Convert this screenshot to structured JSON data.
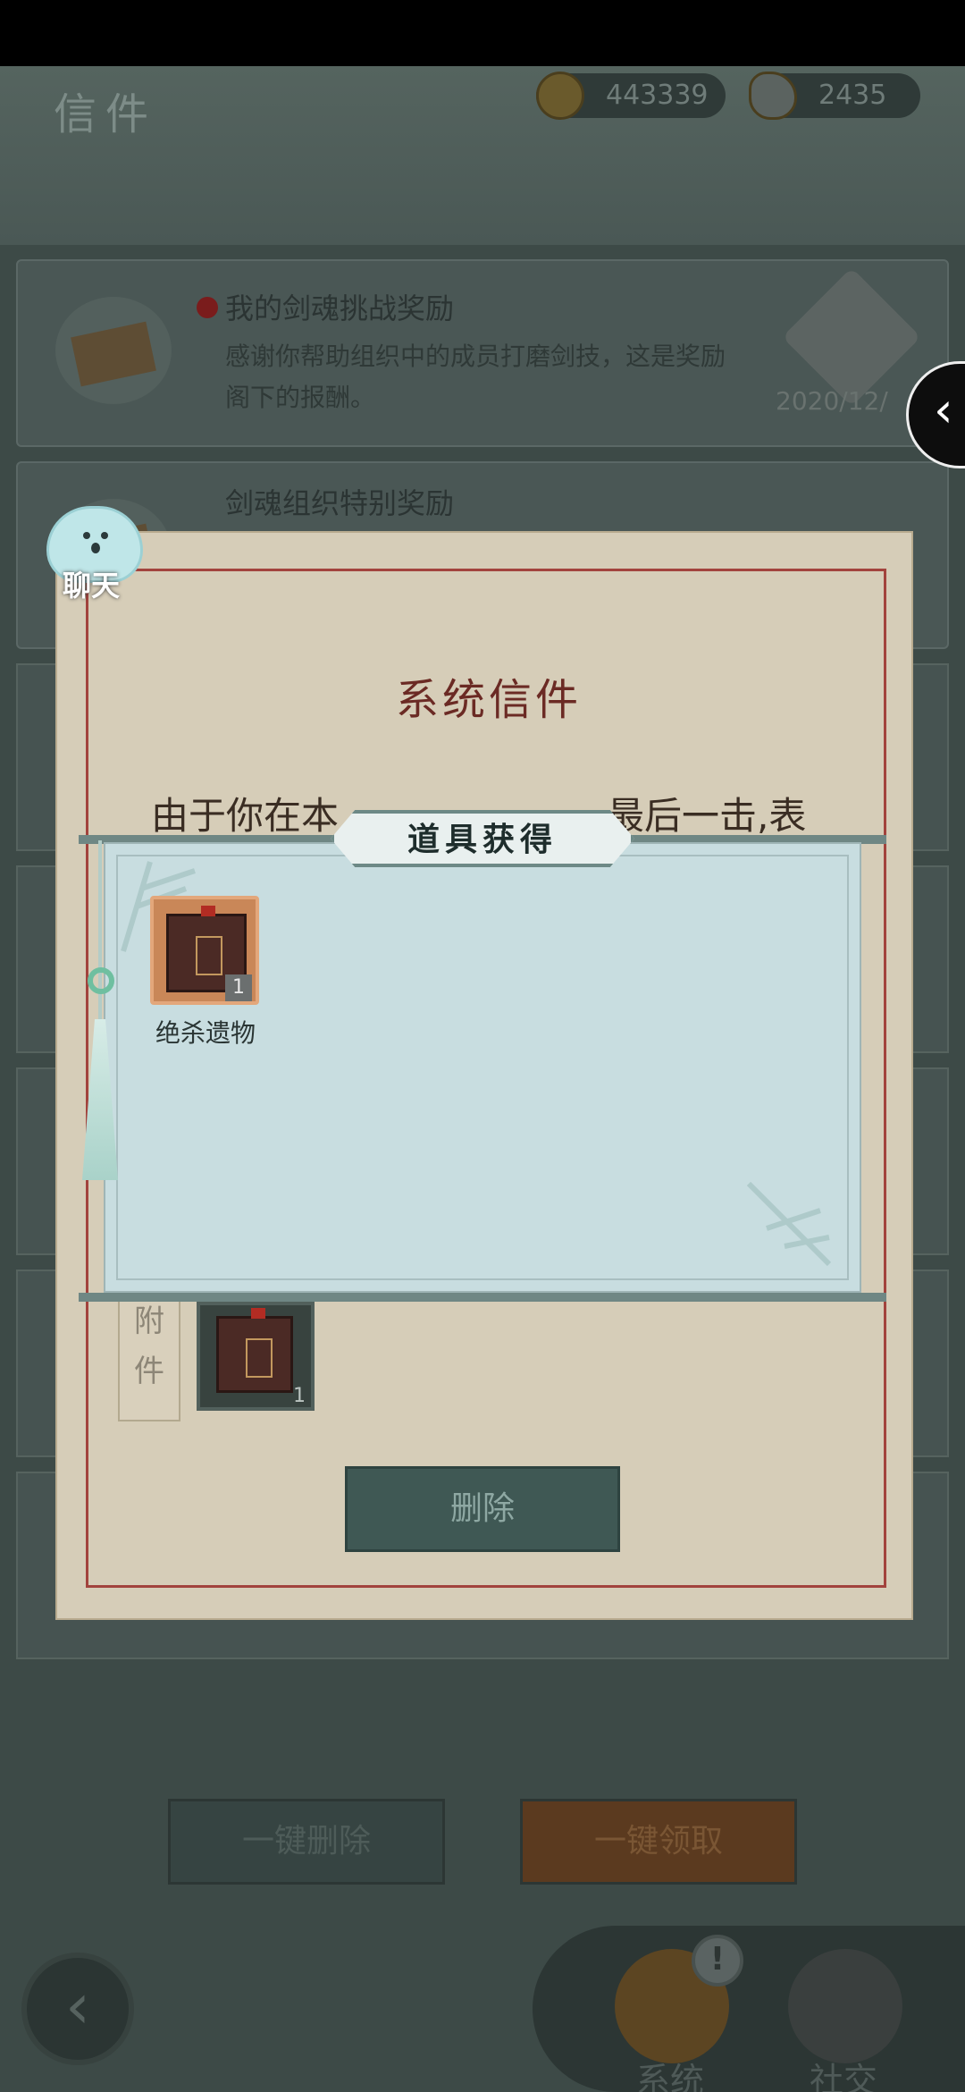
{
  "header": {
    "title": "信件"
  },
  "currency": {
    "coins": "443339",
    "ingots": "2435"
  },
  "mails": [
    {
      "title": "我的剑魂挑战奖励",
      "body": "感谢你帮助组织中的成员打磨剑技，这是奖励阁下的报酬。",
      "date": "2020/12/"
    },
    {
      "title": "剑魂组织特别奖励"
    }
  ],
  "letter": {
    "title": "系统信件",
    "text_left": "由于你在本",
    "text_right": "最后一击,表",
    "attach_label": "附件",
    "attach_count": "1",
    "delete_label": "删除"
  },
  "chat": {
    "label": "聊天"
  },
  "dialog": {
    "title": "道具获得",
    "item": {
      "name": "绝杀遗物",
      "count": "1"
    }
  },
  "footer": {
    "delete_all": "一键删除",
    "claim_all": "一键领取",
    "tab_system": "系统",
    "tab_social": "社交",
    "badge": "!"
  },
  "colors": {
    "dialog_bg": "#c8dde0",
    "item_bg": "#c98758",
    "letter_border": "#a2433d"
  }
}
